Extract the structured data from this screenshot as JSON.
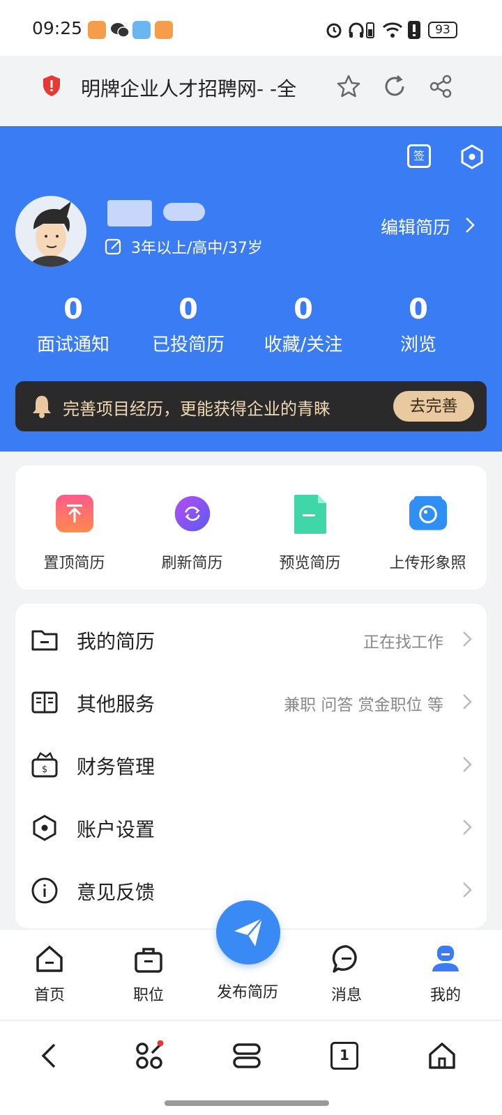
{
  "status_bar": {
    "time": "09:25",
    "battery": "93"
  },
  "browser": {
    "page_title": "明牌企业人才招聘网- -全"
  },
  "header": {
    "sign_in_icon_text": "签",
    "profile": {
      "details": "3年以上/高中/37岁",
      "edit_resume": "编辑简历"
    },
    "stats": [
      {
        "value": "0",
        "label": "面试通知"
      },
      {
        "value": "0",
        "label": "已投简历"
      },
      {
        "value": "0",
        "label": "收藏/关注"
      },
      {
        "value": "0",
        "label": "浏览"
      }
    ],
    "banner": {
      "text": "完善项目经历，更能获得企业的青睐",
      "button": "去完善"
    }
  },
  "quick_actions": [
    {
      "label": "置顶简历",
      "icon": "pin-top-icon",
      "color": "#f8577c"
    },
    {
      "label": "刷新简历",
      "icon": "refresh-icon",
      "color": "#8a50f0"
    },
    {
      "label": "预览简历",
      "icon": "document-icon",
      "color": "#3fd6a8"
    },
    {
      "label": "上传形象照",
      "icon": "camera-icon",
      "color": "#2f8ff5"
    }
  ],
  "menu": [
    {
      "label": "我的简历",
      "value": "正在找工作",
      "icon": "folder-icon"
    },
    {
      "label": "其他服务",
      "value": "兼职 问答 赏金职位 等",
      "icon": "book-icon"
    },
    {
      "label": "财务管理",
      "value": "",
      "icon": "wallet-icon"
    },
    {
      "label": "账户设置",
      "value": "",
      "icon": "settings-hex-icon"
    },
    {
      "label": "意见反馈",
      "value": "",
      "icon": "info-icon"
    }
  ],
  "tabbar": {
    "tabs": [
      {
        "label": "首页",
        "icon": "home-icon"
      },
      {
        "label": "职位",
        "icon": "briefcase-icon"
      },
      {
        "label": "发布简历",
        "icon": "paper-plane-icon"
      },
      {
        "label": "消息",
        "icon": "message-icon"
      },
      {
        "label": "我的",
        "icon": "profile-icon"
      }
    ],
    "active": "我的"
  },
  "nav": {
    "tab_count": "1"
  },
  "colors": {
    "primary": "#3a7cf4",
    "banner_bg": "#2a2a2a",
    "banner_btn": "#e9c9a0"
  }
}
